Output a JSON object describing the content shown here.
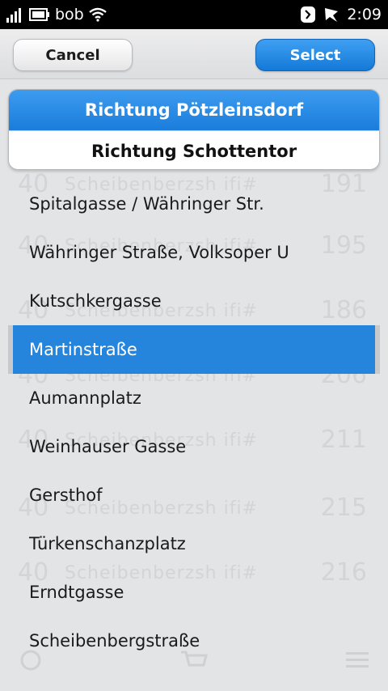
{
  "status_bar": {
    "carrier": "bob",
    "time": "2:09"
  },
  "toolbar": {
    "cancel_label": "Cancel",
    "select_label": "Select"
  },
  "direction": {
    "options": [
      {
        "label": "Richtung Pötzleinsdorf",
        "selected": true
      },
      {
        "label": "Richtung Schottentor",
        "selected": false
      }
    ]
  },
  "stops": [
    {
      "label": "Spitalgasse / Währinger Str."
    },
    {
      "label": "Währinger Straße, Volksoper U"
    },
    {
      "label": "Kutschkergasse"
    },
    {
      "label": "Martinstraße",
      "selected": true
    },
    {
      "label": "Aumannplatz"
    },
    {
      "label": "Weinhauser Gasse"
    },
    {
      "label": "Gersthof"
    },
    {
      "label": "Türkenschanzplatz"
    },
    {
      "label": "Erndtgasse"
    },
    {
      "label": "Scheibenbergstraße"
    }
  ],
  "background_rows": [
    {
      "num": "40",
      "mid": "Scheibenberzsh ifi#",
      "right": "191"
    },
    {
      "num": "40",
      "mid": "Scheibenberzsh ifi#",
      "right": "195"
    },
    {
      "num": "40",
      "mid": "Scheibenberzsh ifi#",
      "right": "186"
    },
    {
      "num": "40",
      "mid": "Scheibenberzsh ifi#",
      "right": "206"
    },
    {
      "num": "40",
      "mid": "Scheibenberzsh ifi#",
      "right": "211"
    },
    {
      "num": "40",
      "mid": "Scheibenberzsh ifi#",
      "right": "215"
    },
    {
      "num": "40",
      "mid": "Scheibenberzsh ifi#",
      "right": "216"
    }
  ],
  "colors": {
    "accent": "#2585dd",
    "background": "#e3e4e6"
  }
}
